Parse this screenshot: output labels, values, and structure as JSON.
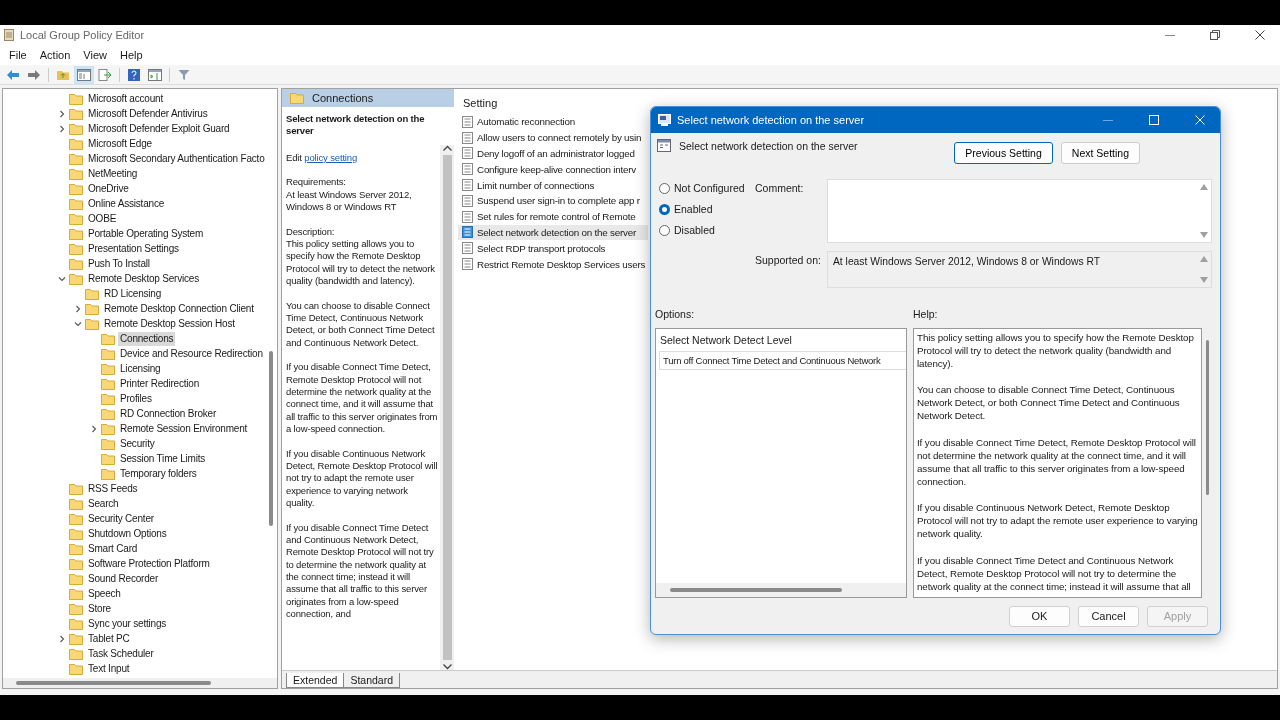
{
  "window": {
    "title": "Local Group Policy Editor"
  },
  "menu": [
    "File",
    "Action",
    "View",
    "Help"
  ],
  "toolbar": [
    {
      "kind": "back",
      "selected": false
    },
    {
      "kind": "forward",
      "selected": false
    },
    {
      "kind": "up",
      "selected": false
    },
    {
      "kind": "tree",
      "selected": true
    },
    {
      "kind": "export",
      "selected": false
    },
    {
      "kind": "help",
      "selected": false
    },
    {
      "kind": "panel",
      "selected": false
    },
    {
      "kind": "filter",
      "selected": false
    }
  ],
  "tree": [
    {
      "label": "Microsoft account",
      "selected": false
    },
    {
      "label": "Microsoft Defender Antivirus",
      "selected": false,
      "expanded": false
    },
    {
      "label": "Microsoft Defender Exploit Guard",
      "selected": false,
      "expanded": false
    },
    {
      "label": "Microsoft Edge",
      "selected": false
    },
    {
      "label": "Microsoft Secondary Authentication Facto",
      "selected": false
    },
    {
      "label": "NetMeeting",
      "selected": false
    },
    {
      "label": "OneDrive",
      "selected": false
    },
    {
      "label": "Online Assistance",
      "selected": false
    },
    {
      "label": "OOBE",
      "selected": false
    },
    {
      "label": "Portable Operating System",
      "selected": false
    },
    {
      "label": "Presentation Settings",
      "selected": false
    },
    {
      "label": "Push To Install",
      "selected": false
    },
    {
      "label": "Remote Desktop Services",
      "selected": false,
      "expanded": true,
      "children": [
        {
          "label": "RD Licensing",
          "selected": false
        },
        {
          "label": "Remote Desktop Connection Client",
          "selected": false,
          "expanded": false
        },
        {
          "label": "Remote Desktop Session Host",
          "selected": false,
          "expanded": true,
          "children": [
            {
              "label": "Connections",
              "selected": true
            },
            {
              "label": "Device and Resource Redirection",
              "selected": false
            },
            {
              "label": "Licensing",
              "selected": false
            },
            {
              "label": "Printer Redirection",
              "selected": false
            },
            {
              "label": "Profiles",
              "selected": false
            },
            {
              "label": "RD Connection Broker",
              "selected": false
            },
            {
              "label": "Remote Session Environment",
              "selected": false,
              "expanded": false
            },
            {
              "label": "Security",
              "selected": false
            },
            {
              "label": "Session Time Limits",
              "selected": false
            },
            {
              "label": "Temporary folders",
              "selected": false
            }
          ]
        }
      ]
    },
    {
      "label": "RSS Feeds",
      "selected": false
    },
    {
      "label": "Search",
      "selected": false
    },
    {
      "label": "Security Center",
      "selected": false
    },
    {
      "label": "Shutdown Options",
      "selected": false
    },
    {
      "label": "Smart Card",
      "selected": false
    },
    {
      "label": "Software Protection Platform",
      "selected": false
    },
    {
      "label": "Sound Recorder",
      "selected": false
    },
    {
      "label": "Speech",
      "selected": false
    },
    {
      "label": "Store",
      "selected": false
    },
    {
      "label": "Sync your settings",
      "selected": false
    },
    {
      "label": "Tablet PC",
      "selected": false,
      "expanded": false
    },
    {
      "label": "Task Scheduler",
      "selected": false
    },
    {
      "label": "Text Input",
      "selected": false
    }
  ],
  "details": {
    "header": "Connections",
    "title": "Select network detection on the server",
    "edit_prefix": "Edit",
    "edit_link": "policy setting",
    "requirements_label": "Requirements:",
    "requirements": "At least Windows Server 2012, Windows 8 or Windows RT",
    "description_label": "Description:",
    "paragraphs": [
      "This policy setting allows you to specify how the Remote Desktop Protocol will try to detect the network quality (bandwidth and latency).",
      "You can choose to disable Connect Time Detect, Continuous Network Detect, or both Connect Time Detect and Continuous Network Detect.",
      "If you disable Connect Time Detect, Remote Desktop Protocol will not determine the network quality at the connect time, and it will assume that all traffic to this server originates from a low-speed connection.",
      "If you disable Continuous Network Detect, Remote Desktop Protocol will not try to adapt the remote user experience to varying network quality.",
      "If you disable Connect Time Detect and Continuous Network Detect, Remote Desktop Protocol will not try to determine the network quality at the connect time; instead it will assume that all traffic to this server originates from a low-speed connection, and"
    ]
  },
  "settings": {
    "column": "Setting",
    "items": [
      {
        "label": "Automatic reconnection",
        "selected": false
      },
      {
        "label": "Allow users to connect remotely by usin",
        "selected": false
      },
      {
        "label": "Deny logoff of an administrator logged",
        "selected": false
      },
      {
        "label": "Configure keep-alive connection interv",
        "selected": false
      },
      {
        "label": "Limit number of connections",
        "selected": false
      },
      {
        "label": "Suspend user sign-in to complete app r",
        "selected": false
      },
      {
        "label": "Set rules for remote control of Remote",
        "selected": false
      },
      {
        "label": "Select network detection on the server",
        "selected": true
      },
      {
        "label": "Select RDP transport protocols",
        "selected": false
      },
      {
        "label": "Restrict Remote Desktop Services users",
        "selected": false
      }
    ]
  },
  "view_tabs": [
    {
      "label": "Extended",
      "selected": true
    },
    {
      "label": "Standard",
      "selected": false
    }
  ],
  "dialog": {
    "title": "Select network detection on the server",
    "heading": "Select network detection on the server",
    "nav_buttons": [
      {
        "label": "Previous Setting",
        "selected": true
      },
      {
        "label": "Next Setting",
        "selected": false
      }
    ],
    "states": [
      {
        "label": "Not Configured",
        "selected": false
      },
      {
        "label": "Enabled",
        "selected": true
      },
      {
        "label": "Disabled",
        "selected": false
      }
    ],
    "comment_label": "Comment:",
    "supported_label": "Supported on:",
    "supported": "At least Windows Server 2012, Windows 8 or Windows RT",
    "options_label": "Options:",
    "help_label": "Help:",
    "option_heading": "Select Network Detect Level",
    "option_value": "Turn off Connect Time Detect and Continuous Network",
    "help": [
      "This policy setting allows you to specify how the Remote Desktop Protocol will try to detect the network quality (bandwidth and latency).",
      "You can choose to disable Connect Time Detect, Continuous Network Detect, or both Connect Time Detect and Continuous Network Detect.",
      "If you disable Connect Time Detect, Remote Desktop Protocol will not determine the network quality at the connect time, and it will assume that all traffic to this server originates from a low-speed connection.",
      "If you disable Continuous Network Detect, Remote Desktop Protocol will not try to adapt the remote user experience to varying network quality.",
      "If you disable Connect Time Detect and Continuous Network Detect, Remote Desktop Protocol will not try to determine the network quality at the connect time; instead it will assume that all"
    ],
    "buttons": [
      {
        "label": "OK",
        "disabled": false
      },
      {
        "label": "Cancel",
        "disabled": false
      },
      {
        "label": "Apply",
        "disabled": true
      }
    ]
  }
}
